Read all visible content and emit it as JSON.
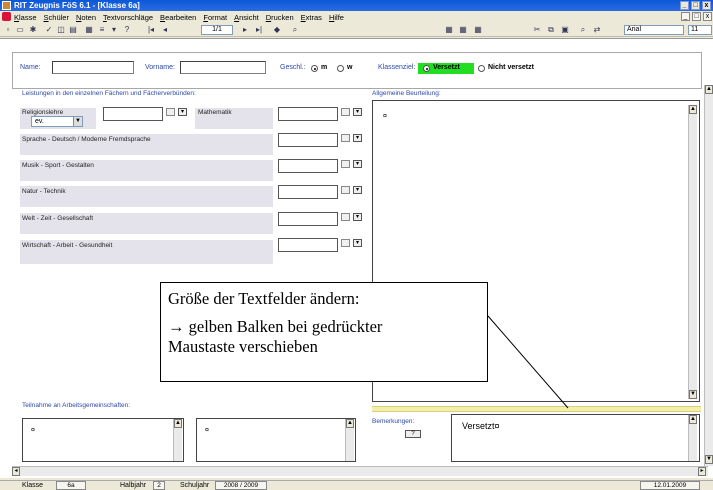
{
  "window": {
    "title": "RIT Zeugnis FöS  6.1 - [Klasse 6a]",
    "controls": [
      "_",
      "□",
      "x"
    ]
  },
  "menu": {
    "items": [
      "Klasse",
      "Schüler",
      "Noten",
      "Textvorschläge",
      "Bearbeiten",
      "Format",
      "Ansicht",
      "Drucken",
      "Extras",
      "Hilfe"
    ]
  },
  "toolbar": {
    "page_display": "1/1",
    "font_name": "Arial",
    "font_size": "11"
  },
  "student": {
    "name_label": "Name:",
    "vorname_label": "Vorname:",
    "gender_label": "Geschl.:",
    "gender_m": "m",
    "gender_w": "w",
    "gender_selected": "m",
    "class_goal_label": "Klassenziel:",
    "versetzt_label": "Versetzt",
    "nicht_versetzt_label": "Nicht versetzt",
    "class_goal_selected": "Versetzt"
  },
  "grades": {
    "section_title": "Leistungen in den einzelnen Fächern und Fächerverbünden:",
    "religion_label": "Religionslehre",
    "religion_value": "ev.",
    "mathematik_label": "Mathematik",
    "subjects": [
      "Sprache - Deutsch / Moderne Fremdsprache",
      "Musik - Sport - Gestalten",
      "Natur - Technik",
      "Welt - Zeit - Gesellschaft",
      "Wirtschaft - Arbeit - Gesundheit"
    ]
  },
  "assessment": {
    "title": "Allgemeine Beurteilung:",
    "content": "¤"
  },
  "callout": {
    "line1": "Größe der Textfelder ändern:",
    "line2": "→ gelben Balken bei gedrückter",
    "line3": "Maustaste verschieben"
  },
  "ags": {
    "title": "Teilnahme an Arbeitsgemeinschaften:",
    "box1": "¤",
    "box2": "¤"
  },
  "remarks": {
    "title": "Bemerkungen:",
    "dropdown": "?",
    "content": "Versetzt¤"
  },
  "status": {
    "klasse_label": "Klasse",
    "klasse_value": "6a",
    "halbjahr_label": "Halbjahr",
    "halbjahr_value": "2",
    "schuljahr_label": "Schuljahr",
    "schuljahr_value": "2008 / 2009",
    "date": "12.01.2009"
  },
  "colors": {
    "titlebar": "#0a58d8",
    "label_blue": "#2a49a8",
    "versetzt_green": "#22dd22",
    "resize_bar_yellow": "#f5f0a8"
  }
}
